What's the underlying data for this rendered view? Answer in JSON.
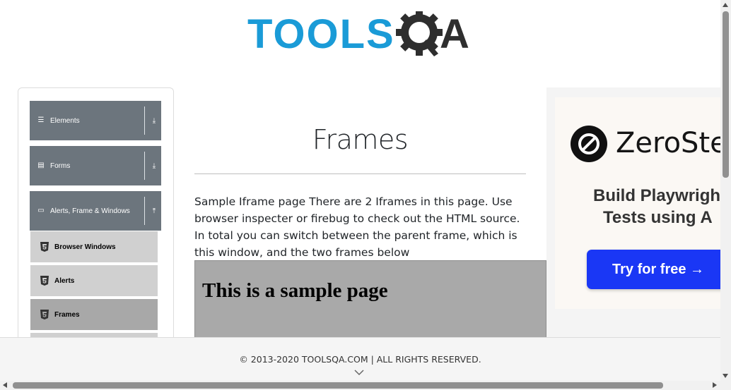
{
  "header": {
    "logo_text": "TOOLSQA"
  },
  "sidebar": {
    "groups": [
      {
        "label": "Elements",
        "icon": "hamburger-icon"
      },
      {
        "label": "Forms",
        "icon": "form-icon"
      },
      {
        "label": "Alerts, Frame & Windows",
        "icon": "window-icon"
      }
    ],
    "items": [
      {
        "label": "Browser Windows"
      },
      {
        "label": "Alerts"
      },
      {
        "label": "Frames",
        "active": true
      }
    ]
  },
  "main": {
    "title": "Frames",
    "description": "Sample Iframe page There are 2 Iframes in this page. Use browser inspecter or firebug to check out the HTML source. In total you can switch between the parent frame, which is this window, and the two frames below",
    "frame_heading": "This is a sample page"
  },
  "ad": {
    "brand": "ZeroSte",
    "line1": "Build Playwrigh",
    "line2": "Tests using A",
    "button": "Try for free →"
  },
  "footer": {
    "copyright": "© 2013-2020 TOOLSQA.COM | ALL RIGHTS RESERVED."
  },
  "colors": {
    "accent": "#1a9bd7",
    "sidebar_group": "#6c757d",
    "ad_button": "#1a37f5"
  }
}
